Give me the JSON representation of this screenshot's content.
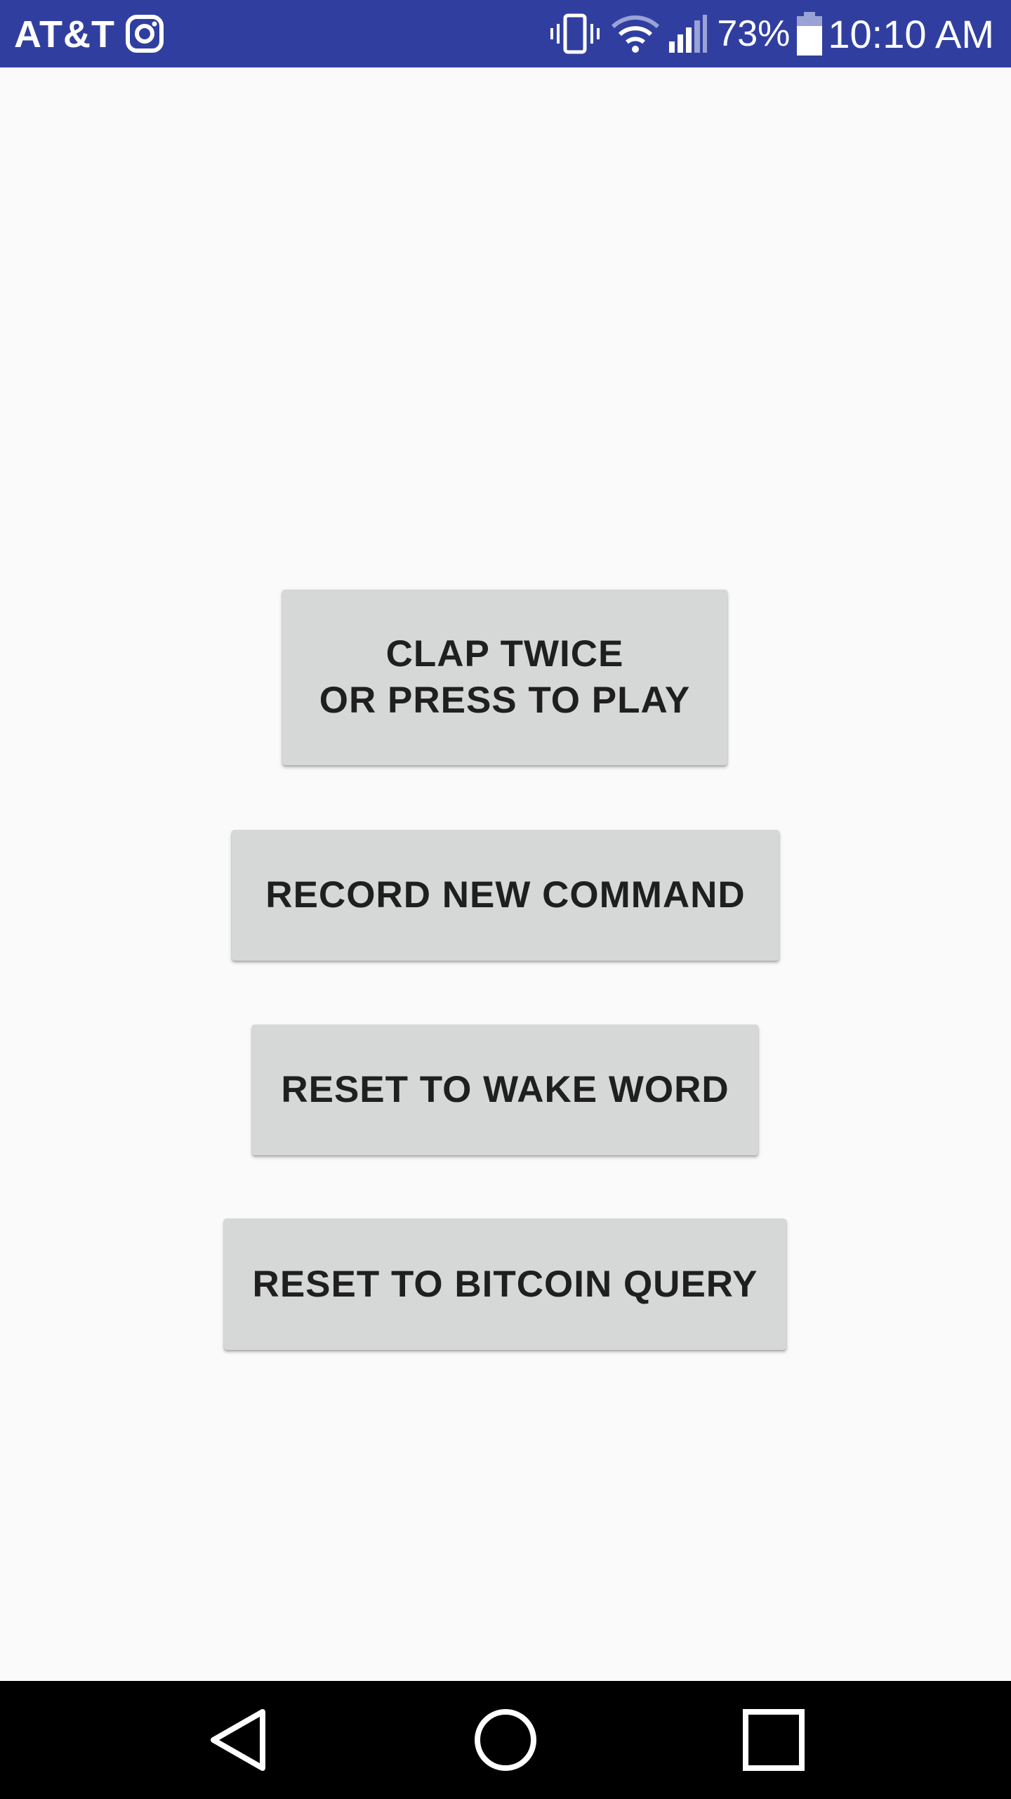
{
  "status_bar": {
    "carrier": "AT&T",
    "battery_percent": "73%",
    "time": "10:10 AM",
    "icons": [
      "instagram-icon",
      "vibrate-icon",
      "wifi-icon",
      "signal-icon",
      "battery-icon"
    ]
  },
  "buttons": {
    "play_line1": "CLAP TWICE",
    "play_line2": "OR PRESS TO PLAY",
    "record": "RECORD NEW COMMAND",
    "reset_wake": "RESET TO WAKE WORD",
    "reset_bitcoin": "RESET TO BITCOIN QUERY"
  },
  "nav_bar": {
    "icons": [
      "back-icon",
      "home-icon",
      "recents-icon"
    ]
  },
  "colors": {
    "status_bar": "#303f9f",
    "background": "#fafafa",
    "button": "#d6d7d7",
    "button_text": "#1f1f1f",
    "nav_bar": "#000000"
  }
}
